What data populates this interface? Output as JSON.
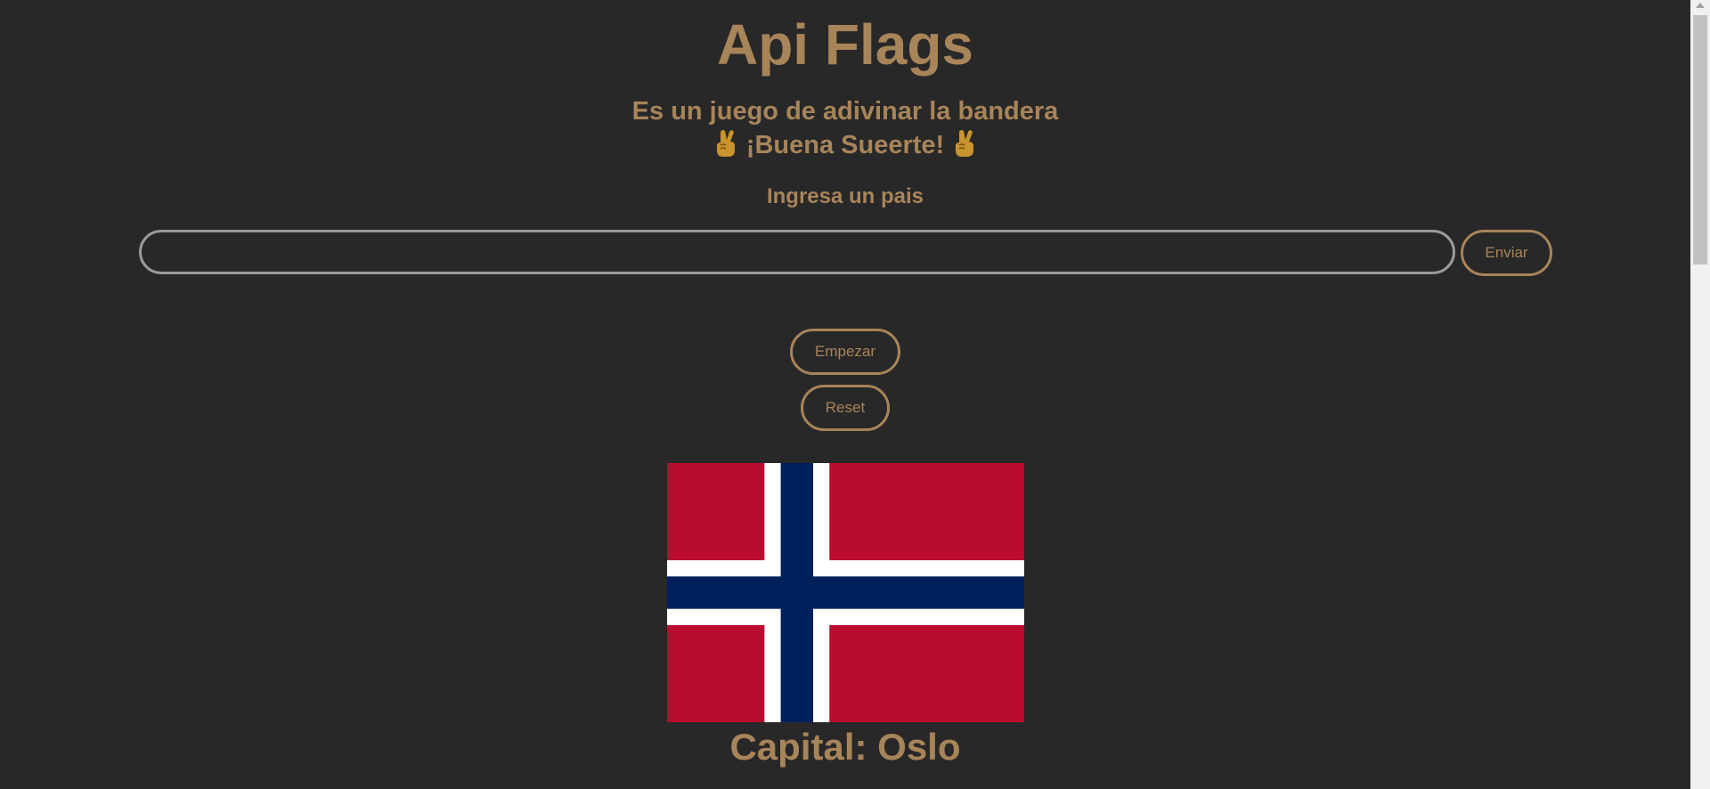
{
  "header": {
    "title": "Api Flags",
    "subtitle_line1": "Es un juego de adivinar la bandera",
    "subtitle_line2": "¡Buena Sueerte!"
  },
  "form": {
    "prompt": "Ingresa un pais",
    "input_value": "",
    "input_placeholder": "",
    "send_label": "Enviar"
  },
  "controls": {
    "start_label": "Empezar",
    "reset_label": "Reset"
  },
  "result": {
    "flag_icon": "norway-flag",
    "capital_text": "Capital: Oslo"
  },
  "colors": {
    "background": "#282828",
    "accent": "#a88459",
    "flag_red": "#ba0c2f",
    "flag_white": "#ffffff",
    "flag_blue": "#00205b"
  }
}
